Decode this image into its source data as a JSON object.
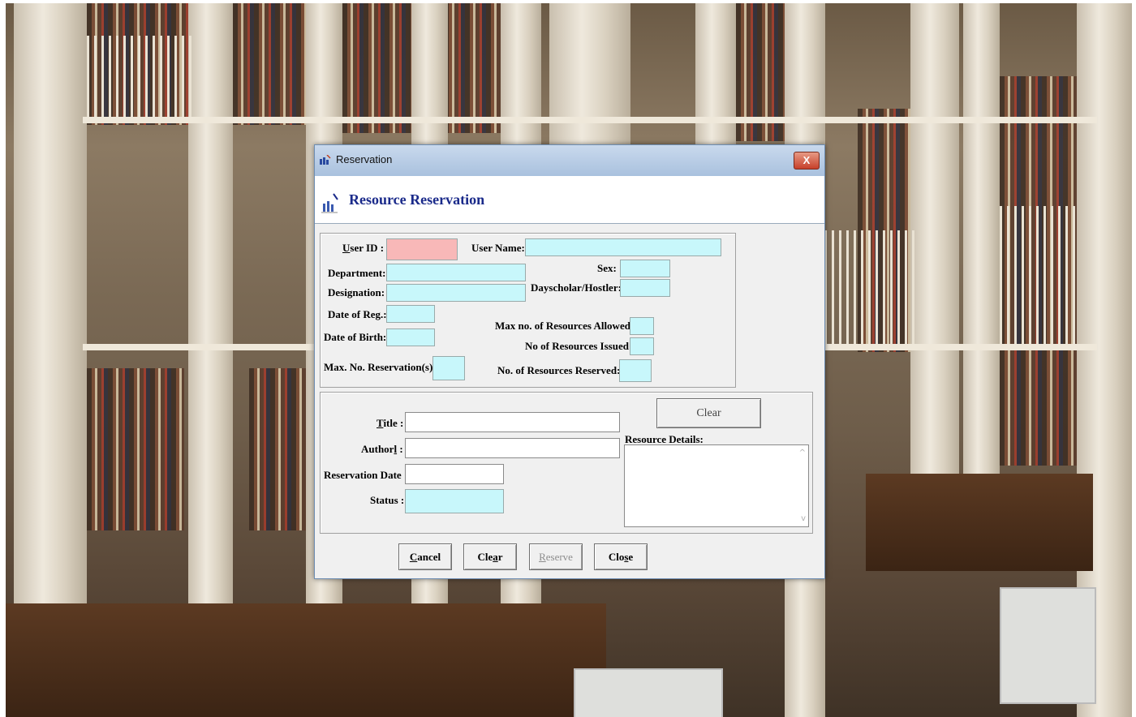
{
  "window": {
    "title": "Reservation",
    "close_symbol": "X"
  },
  "header": {
    "title": "Resource Reservation"
  },
  "user_info": {
    "user_id": {
      "label": "User ID :",
      "mnemonic": "U",
      "label_rest": "ser ID :",
      "value": ""
    },
    "user_name": {
      "label": "User Name:",
      "value": ""
    },
    "department": {
      "label": "Department:",
      "value": ""
    },
    "sex": {
      "label": "Sex:",
      "value": ""
    },
    "designation": {
      "label": "Designation:",
      "value": ""
    },
    "dayscholar": {
      "label": "Dayscholar/Hostler:",
      "value": ""
    },
    "date_of_reg": {
      "label": "Date of Reg.:",
      "value": ""
    },
    "max_resources_allowed": {
      "label": "Max no. of Resources Allowed:",
      "value": ""
    },
    "date_of_birth": {
      "label": "Date of Birth:",
      "value": ""
    },
    "resources_issued": {
      "label": "No of Resources Issued:",
      "value": ""
    },
    "max_reservations": {
      "label": "Max. No. Reservation(s) :",
      "value": ""
    },
    "resources_reserved": {
      "label": "No. of Resources Reserved:",
      "value": ""
    }
  },
  "resource": {
    "title": {
      "mnemonic": "T",
      "label_rest": "itle :",
      "value": ""
    },
    "author": {
      "label_pre": "Author",
      "mnemonic": "l",
      "label_rest": " :",
      "value": ""
    },
    "reservation_date": {
      "label": "Reservation Date :",
      "value": ""
    },
    "status": {
      "label": "Status :",
      "value": ""
    },
    "clear_label": "Clear",
    "details_label": "Resource Details:",
    "details_value": "",
    "scroll_up": "^",
    "scroll_down": "v"
  },
  "footer": {
    "cancel": {
      "mnemonic": "C",
      "rest": "ancel"
    },
    "clear": {
      "pre": "Cle",
      "mnemonic": "a",
      "rest": "r"
    },
    "reserve": {
      "mnemonic": "R",
      "rest": "eserve"
    },
    "close": {
      "pre": "Clo",
      "mnemonic": "s",
      "rest": "e"
    }
  },
  "colors": {
    "required_field": "#f8b8b8",
    "readonly_field": "#c8f7fb",
    "header_title": "#1a2a8a"
  }
}
